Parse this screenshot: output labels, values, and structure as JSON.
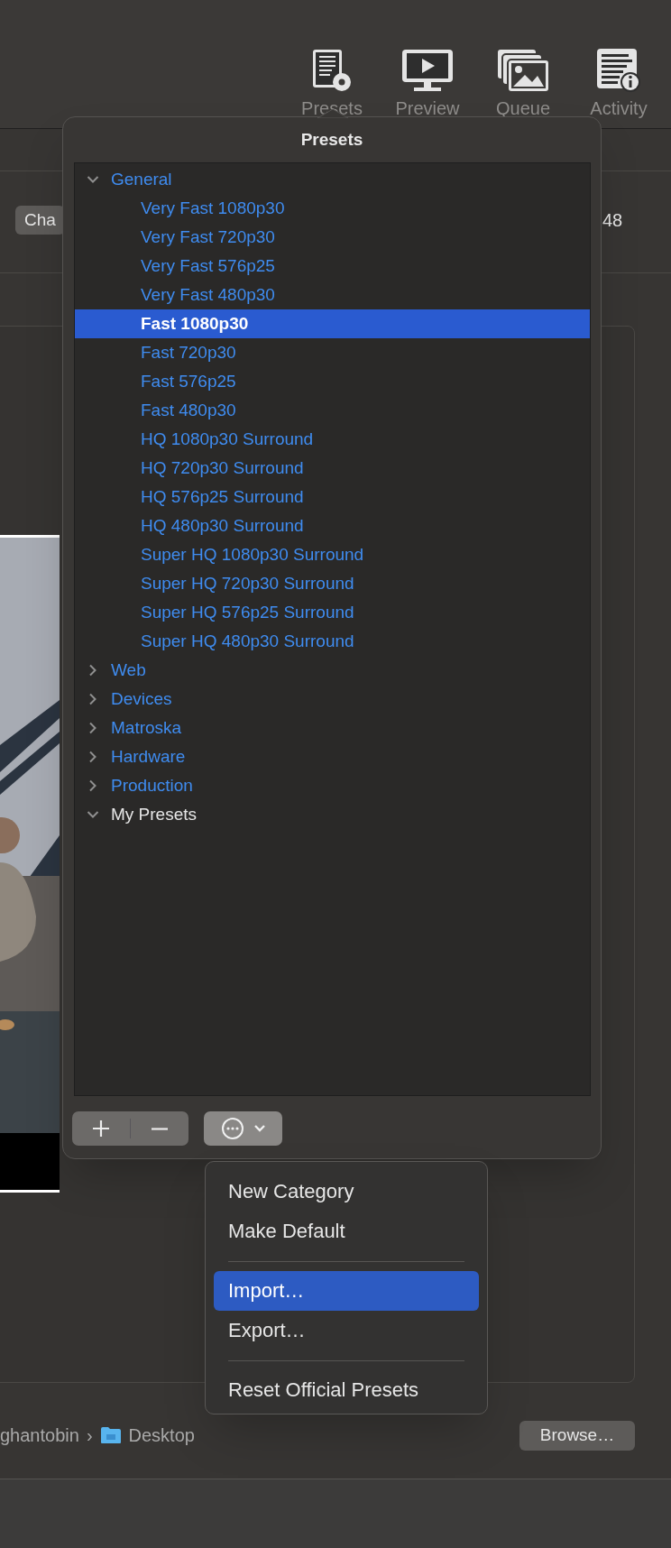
{
  "toolbar": [
    {
      "kind": "presets",
      "label": "Presets"
    },
    {
      "kind": "preview",
      "label": "Preview"
    },
    {
      "kind": "queue",
      "label": "Queue"
    },
    {
      "kind": "activity",
      "label": "Activity"
    }
  ],
  "background": {
    "button_partial": "Cha",
    "value_partial": "48",
    "path": [
      {
        "kind": "text",
        "label": "ghantobin"
      },
      {
        "kind": "separator",
        "label": "›"
      },
      {
        "kind": "folder",
        "label": "Desktop"
      }
    ],
    "browse_button": "Browse…"
  },
  "presets_popover": {
    "title": "Presets",
    "tree": [
      {
        "label": "General",
        "official": true,
        "expanded": true,
        "children": [
          {
            "label": "Very Fast 1080p30",
            "selected": false
          },
          {
            "label": "Very Fast 720p30",
            "selected": false
          },
          {
            "label": "Very Fast 576p25",
            "selected": false
          },
          {
            "label": "Very Fast 480p30",
            "selected": false
          },
          {
            "label": "Fast 1080p30",
            "selected": true
          },
          {
            "label": "Fast 720p30",
            "selected": false
          },
          {
            "label": "Fast 576p25",
            "selected": false
          },
          {
            "label": "Fast 480p30",
            "selected": false
          },
          {
            "label": "HQ 1080p30 Surround",
            "selected": false
          },
          {
            "label": "HQ 720p30 Surround",
            "selected": false
          },
          {
            "label": "HQ 576p25 Surround",
            "selected": false
          },
          {
            "label": "HQ 480p30 Surround",
            "selected": false
          },
          {
            "label": "Super HQ 1080p30 Surround",
            "selected": false
          },
          {
            "label": "Super HQ 720p30 Surround",
            "selected": false
          },
          {
            "label": "Super HQ 576p25 Surround",
            "selected": false
          },
          {
            "label": "Super HQ 480p30 Surround",
            "selected": false
          }
        ]
      },
      {
        "label": "Web",
        "official": true,
        "expanded": false
      },
      {
        "label": "Devices",
        "official": true,
        "expanded": false
      },
      {
        "label": "Matroska",
        "official": true,
        "expanded": false
      },
      {
        "label": "Hardware",
        "official": true,
        "expanded": false
      },
      {
        "label": "Production",
        "official": true,
        "expanded": false
      },
      {
        "label": "My Presets",
        "official": false,
        "expanded": true
      }
    ],
    "buttons": [
      {
        "kind": "add"
      },
      {
        "kind": "remove"
      },
      {
        "kind": "actions"
      }
    ]
  },
  "actions_menu": [
    {
      "kind": "item",
      "label": "New Category",
      "selected": false
    },
    {
      "kind": "item",
      "label": "Make Default",
      "selected": false
    },
    {
      "kind": "separator"
    },
    {
      "kind": "item",
      "label": "Import…",
      "selected": true
    },
    {
      "kind": "item",
      "label": "Export…",
      "selected": false
    },
    {
      "kind": "separator"
    },
    {
      "kind": "item",
      "label": "Reset Official Presets",
      "selected": false
    }
  ]
}
